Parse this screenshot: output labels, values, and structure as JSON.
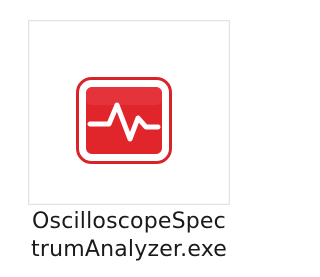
{
  "file": {
    "name_line1": "OscilloscopeSpec",
    "name_line2": "trumAnalyzer.exe",
    "icon": "oscilloscope-app-icon",
    "icon_color": "#e0252b"
  }
}
